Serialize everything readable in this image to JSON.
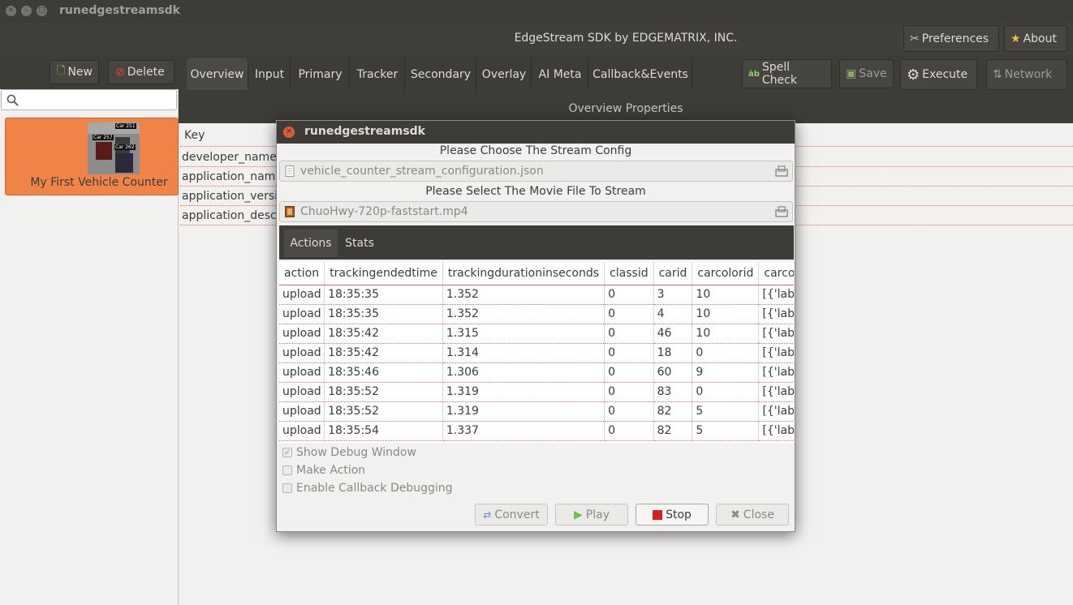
{
  "window": {
    "title": "runedgestreamsdk"
  },
  "header": {
    "title": "EdgeStream SDK by EDGEMATRIX, INC.",
    "preferences_label": "Preferences",
    "about_label": "About"
  },
  "sidebar": {
    "new_label": "New",
    "delete_label": "Delete",
    "search_placeholder": "",
    "items": [
      {
        "label": "My First Vehicle Counter",
        "thumb_tags": [
          "Car 251",
          "Car 257",
          "Car 262"
        ]
      }
    ]
  },
  "tabs": [
    "Overview",
    "Input",
    "Primary",
    "Tracker",
    "Secondary",
    "Overlay",
    "AI Meta",
    "Callback&Events"
  ],
  "toolbar": {
    "spell_check_label": "Spell Check",
    "save_label": "Save",
    "execute_label": "Execute",
    "network_label": "Network"
  },
  "overview": {
    "section_title": "Overview Properties",
    "key_header": "Key",
    "keys": [
      "developer_name",
      "application_name",
      "application_version",
      "application_description"
    ]
  },
  "dialog": {
    "title": "runedgestreamsdk",
    "config_caption": "Please Choose The Stream Config",
    "config_file": "vehicle_counter_stream_configuration.json",
    "movie_caption": "Please Select The Movie File To Stream",
    "movie_file": "ChuoHwy-720p-faststart.mp4",
    "subtabs": [
      "Actions",
      "Stats"
    ],
    "table": {
      "columns": [
        "action",
        "trackingendedtime",
        "trackingdurationinseconds",
        "classid",
        "carid",
        "carcolorid",
        "carcolo"
      ],
      "rows": [
        [
          "upload",
          "18:35:35",
          "1.352",
          "0",
          "3",
          "10",
          "[{'label':"
        ],
        [
          "upload",
          "18:35:35",
          "1.352",
          "0",
          "4",
          "10",
          "[{'label':"
        ],
        [
          "upload",
          "18:35:42",
          "1.315",
          "0",
          "46",
          "10",
          "[{'label':"
        ],
        [
          "upload",
          "18:35:42",
          "1.314",
          "0",
          "18",
          "0",
          "[{'label':"
        ],
        [
          "upload",
          "18:35:46",
          "1.306",
          "0",
          "60",
          "9",
          "[{'label':"
        ],
        [
          "upload",
          "18:35:52",
          "1.319",
          "0",
          "83",
          "0",
          "[{'label':"
        ],
        [
          "upload",
          "18:35:52",
          "1.319",
          "0",
          "82",
          "5",
          "[{'label':"
        ],
        [
          "upload",
          "18:35:54",
          "1.337",
          "0",
          "82",
          "5",
          "[{'label':"
        ]
      ]
    },
    "options": [
      {
        "label": "Show Debug Window",
        "checked": true
      },
      {
        "label": "Make Action",
        "checked": false
      },
      {
        "label": "Enable Callback Debugging",
        "checked": false
      }
    ],
    "buttons": {
      "convert": "Convert",
      "play": "Play",
      "stop": "Stop",
      "close": "Close"
    }
  },
  "colors": {
    "titlebar": "#3d3c37",
    "selected_card": "#f08448",
    "row_divider": "#e06b6b",
    "close_button": "#e05a36",
    "stop_icon": "#d42020",
    "play_icon": "#73c04a"
  }
}
